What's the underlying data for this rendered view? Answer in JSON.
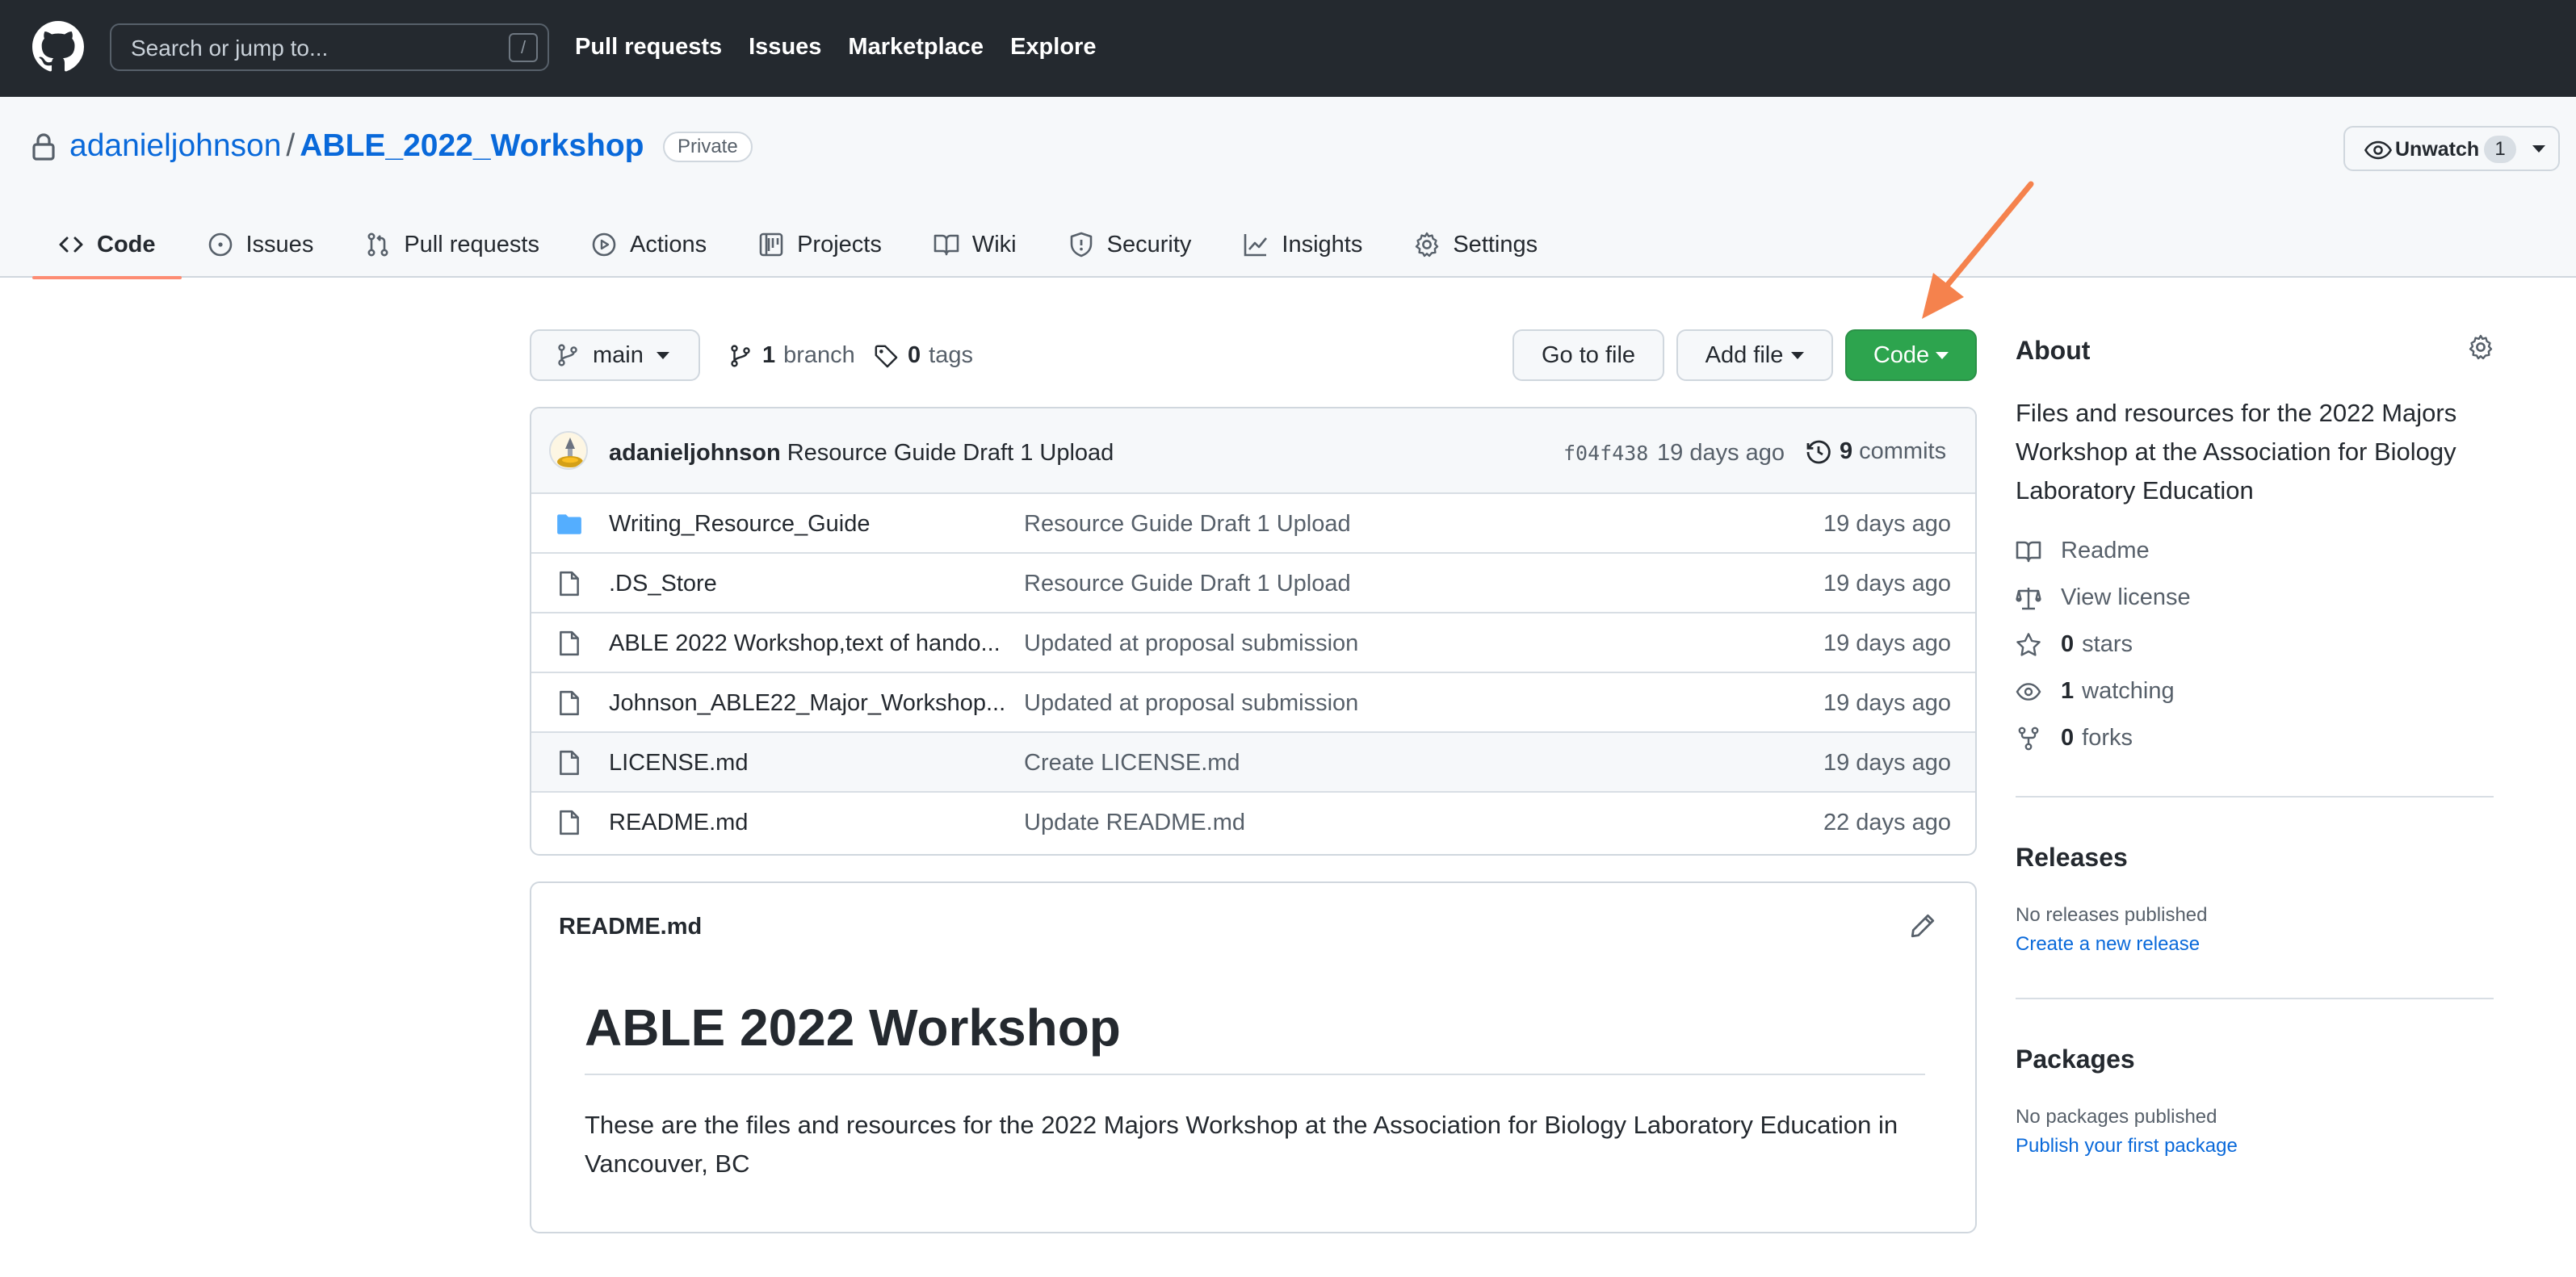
{
  "header": {
    "search_placeholder": "Search or jump to...",
    "search_shortcut": "/",
    "nav": [
      "Pull requests",
      "Issues",
      "Marketplace",
      "Explore"
    ]
  },
  "repo": {
    "owner": "adanieljohnson",
    "separator": "/",
    "name": "ABLE_2022_Workshop",
    "visibility": "Private",
    "watch_label": "Unwatch",
    "watch_count": "1"
  },
  "tabs": [
    {
      "label": "Code",
      "icon": "code-icon"
    },
    {
      "label": "Issues",
      "icon": "issue-icon"
    },
    {
      "label": "Pull requests",
      "icon": "pull-request-icon"
    },
    {
      "label": "Actions",
      "icon": "play-icon"
    },
    {
      "label": "Projects",
      "icon": "project-icon"
    },
    {
      "label": "Wiki",
      "icon": "book-icon"
    },
    {
      "label": "Security",
      "icon": "shield-icon"
    },
    {
      "label": "Insights",
      "icon": "graph-icon"
    },
    {
      "label": "Settings",
      "icon": "gear-icon"
    }
  ],
  "branchbar": {
    "branch": "main",
    "branch_count": "1",
    "branch_label": "branch",
    "tag_count": "0",
    "tag_label": "tags",
    "goto_file": "Go to file",
    "add_file": "Add file",
    "code": "Code"
  },
  "latest_commit": {
    "author": "adanieljohnson",
    "message": "Resource Guide Draft 1 Upload",
    "sha": "f04f438",
    "age": "19 days ago",
    "commit_count": "9",
    "commit_label": "commits"
  },
  "files": [
    {
      "type": "folder",
      "name": "Writing_Resource_Guide",
      "message": "Resource Guide Draft 1 Upload",
      "age": "19 days ago"
    },
    {
      "type": "file",
      "name": ".DS_Store",
      "message": "Resource Guide Draft 1 Upload",
      "age": "19 days ago"
    },
    {
      "type": "file",
      "name": "ABLE 2022 Workshop,text of hando...",
      "message": "Updated at proposal submission",
      "age": "19 days ago"
    },
    {
      "type": "file",
      "name": "Johnson_ABLE22_Major_Workshop...",
      "message": "Updated at proposal submission",
      "age": "19 days ago"
    },
    {
      "type": "file",
      "name": "LICENSE.md",
      "message": "Create LICENSE.md",
      "age": "19 days ago"
    },
    {
      "type": "file",
      "name": "README.md",
      "message": "Update README.md",
      "age": "22 days ago"
    }
  ],
  "readme": {
    "filename": "README.md",
    "title": "ABLE 2022 Workshop",
    "body": "These are the files and resources for the 2022 Majors Workshop at the Association for Biology Laboratory Education in Vancouver, BC"
  },
  "sidebar": {
    "about_heading": "About",
    "description": "Files and resources for the 2022 Majors Workshop at the Association for Biology Laboratory Education",
    "readme_link": "Readme",
    "license_link": "View license",
    "stars_count": "0",
    "stars_label": "stars",
    "watching_count": "1",
    "watching_label": "watching",
    "forks_count": "0",
    "forks_label": "forks",
    "releases_heading": "Releases",
    "releases_none": "No releases published",
    "releases_link": "Create a new release",
    "packages_heading": "Packages",
    "packages_none": "No packages published",
    "packages_link": "Publish your first package"
  },
  "colors": {
    "header_bg": "#24292f",
    "link": "#0969da",
    "code_button": "#2da44e",
    "active_tab_underline": "#fd8c73",
    "annotation_arrow": "#f5824d"
  }
}
